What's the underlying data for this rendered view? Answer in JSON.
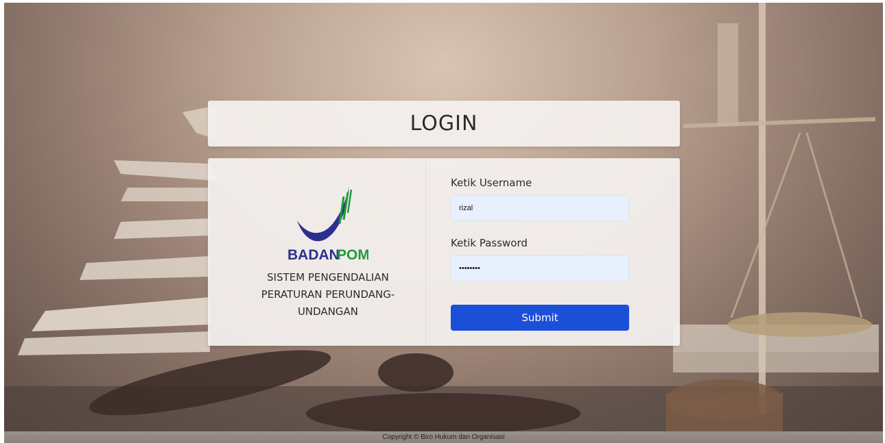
{
  "login": {
    "title": "LOGIN"
  },
  "branding": {
    "logo_text_left": "BADAN",
    "logo_text_right": "POM",
    "system_name": "SISTEM PENGENDALIAN PERATURAN PERUNDANG-UNDANGAN"
  },
  "form": {
    "username_label": "Ketik Username",
    "username_value": "rizal",
    "password_label": "Ketik Password",
    "password_value": "••••••••",
    "submit_label": "Submit"
  },
  "footer": {
    "copyright": "Copyright © Biro Hukum dan Organisasi"
  },
  "colors": {
    "primary_button": "#1c4fd8",
    "logo_blue": "#2b2f8f",
    "logo_green": "#1f9a3a"
  }
}
